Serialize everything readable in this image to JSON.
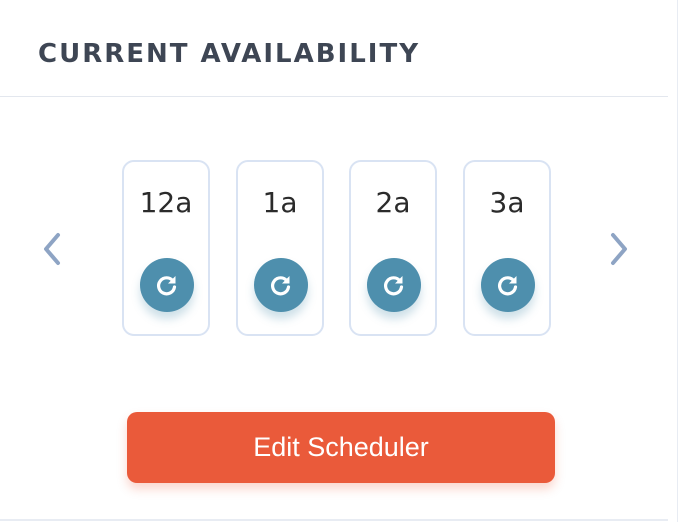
{
  "panel": {
    "title": "CURRENT AVAILABILITY"
  },
  "carousel": {
    "prev_icon": "chevron-left-icon",
    "next_icon": "chevron-right-icon",
    "slots": [
      {
        "label": "12a",
        "icon": "refresh-icon"
      },
      {
        "label": "1a",
        "icon": "refresh-icon"
      },
      {
        "label": "2a",
        "icon": "refresh-icon"
      },
      {
        "label": "3a",
        "icon": "refresh-icon"
      }
    ]
  },
  "actions": {
    "edit_label": "Edit Scheduler"
  },
  "colors": {
    "title": "#3e4654",
    "accent": "#4e8fad",
    "card_border": "#d9e3f3",
    "button": "#ea5a3a",
    "arrow": "#8ea4c4"
  }
}
